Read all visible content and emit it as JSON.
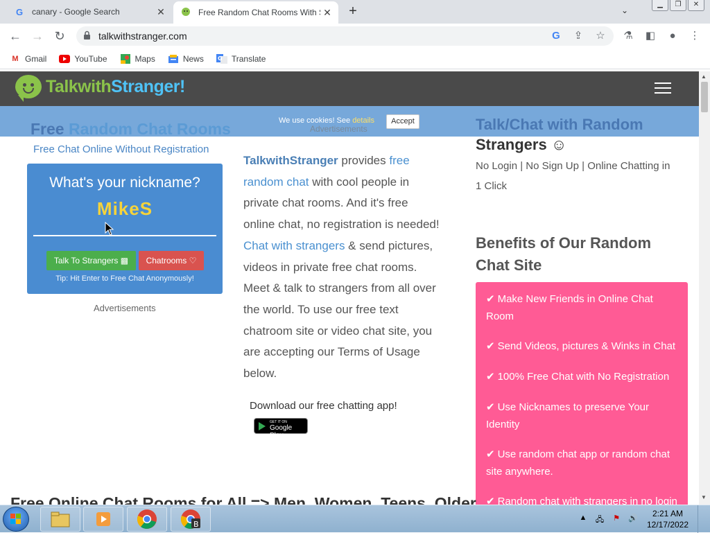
{
  "browser": {
    "tabs": [
      {
        "title": "canary - Google Search",
        "active": false
      },
      {
        "title": "Free Random Chat Rooms With S",
        "active": true
      }
    ],
    "url": "talkwithstranger.com",
    "bookmarks": [
      "Gmail",
      "YouTube",
      "Maps",
      "News",
      "Translate"
    ]
  },
  "site": {
    "logo": {
      "part1": "Talk",
      "part2": "with",
      "part3": "Stranger!"
    },
    "cookie": {
      "text": "We use cookies! See ",
      "link": "details",
      "accept": "Accept"
    },
    "ads_top": "Advertisements",
    "hero": {
      "title_a": "Free ",
      "title_b": "Random Chat Rooms",
      "subtitle": "Free Chat Online Without Registration"
    },
    "nickname": {
      "question": "What's your nickname?",
      "value": "MikeS",
      "btn_talk": "Talk To Strangers",
      "btn_rooms": "Chatrooms",
      "tip": "Tip: Hit Enter to Free Chat Anonymously!"
    },
    "ads_left": "Advertisements",
    "intro": {
      "brand": "TalkwithStranger",
      "t1": " provides ",
      "l1": "free random chat",
      "t2": " with cool people in private chat rooms. And it's free online chat, no registration is needed! ",
      "l2": "Chat with strangers",
      "t3": " & send pictures, videos in private free chat rooms. Meet & talk to strangers from all over the world. To use our free text chatroom site or video chat site, you are accepting our Terms of Usage below."
    },
    "download": "Download our free chatting app!",
    "gplay": {
      "small": "GET IT ON",
      "big": "Google Play"
    },
    "right": {
      "title_a": "Talk/Chat with Random",
      "title_b": "Strangers ☺",
      "sub": "No Login | No Sign Up | Online Chatting in 1 Click",
      "benefits_title": "Benefits of Our Random Chat Site",
      "benefits": [
        "Make New Friends in Online Chat Room",
        "Send Videos, pictures & Winks in Chat",
        "100% Free Chat with No Registration",
        "Use Nicknames to preserve Your Identity",
        "Use random chat app or random chat site anywhere.",
        "Random chat with strangers in no login"
      ]
    },
    "bottom_heading": "Free Online Chat Rooms for All => Men, Women, Teens, Older"
  },
  "taskbar": {
    "time": "2:21 AM",
    "date": "12/17/2022"
  }
}
